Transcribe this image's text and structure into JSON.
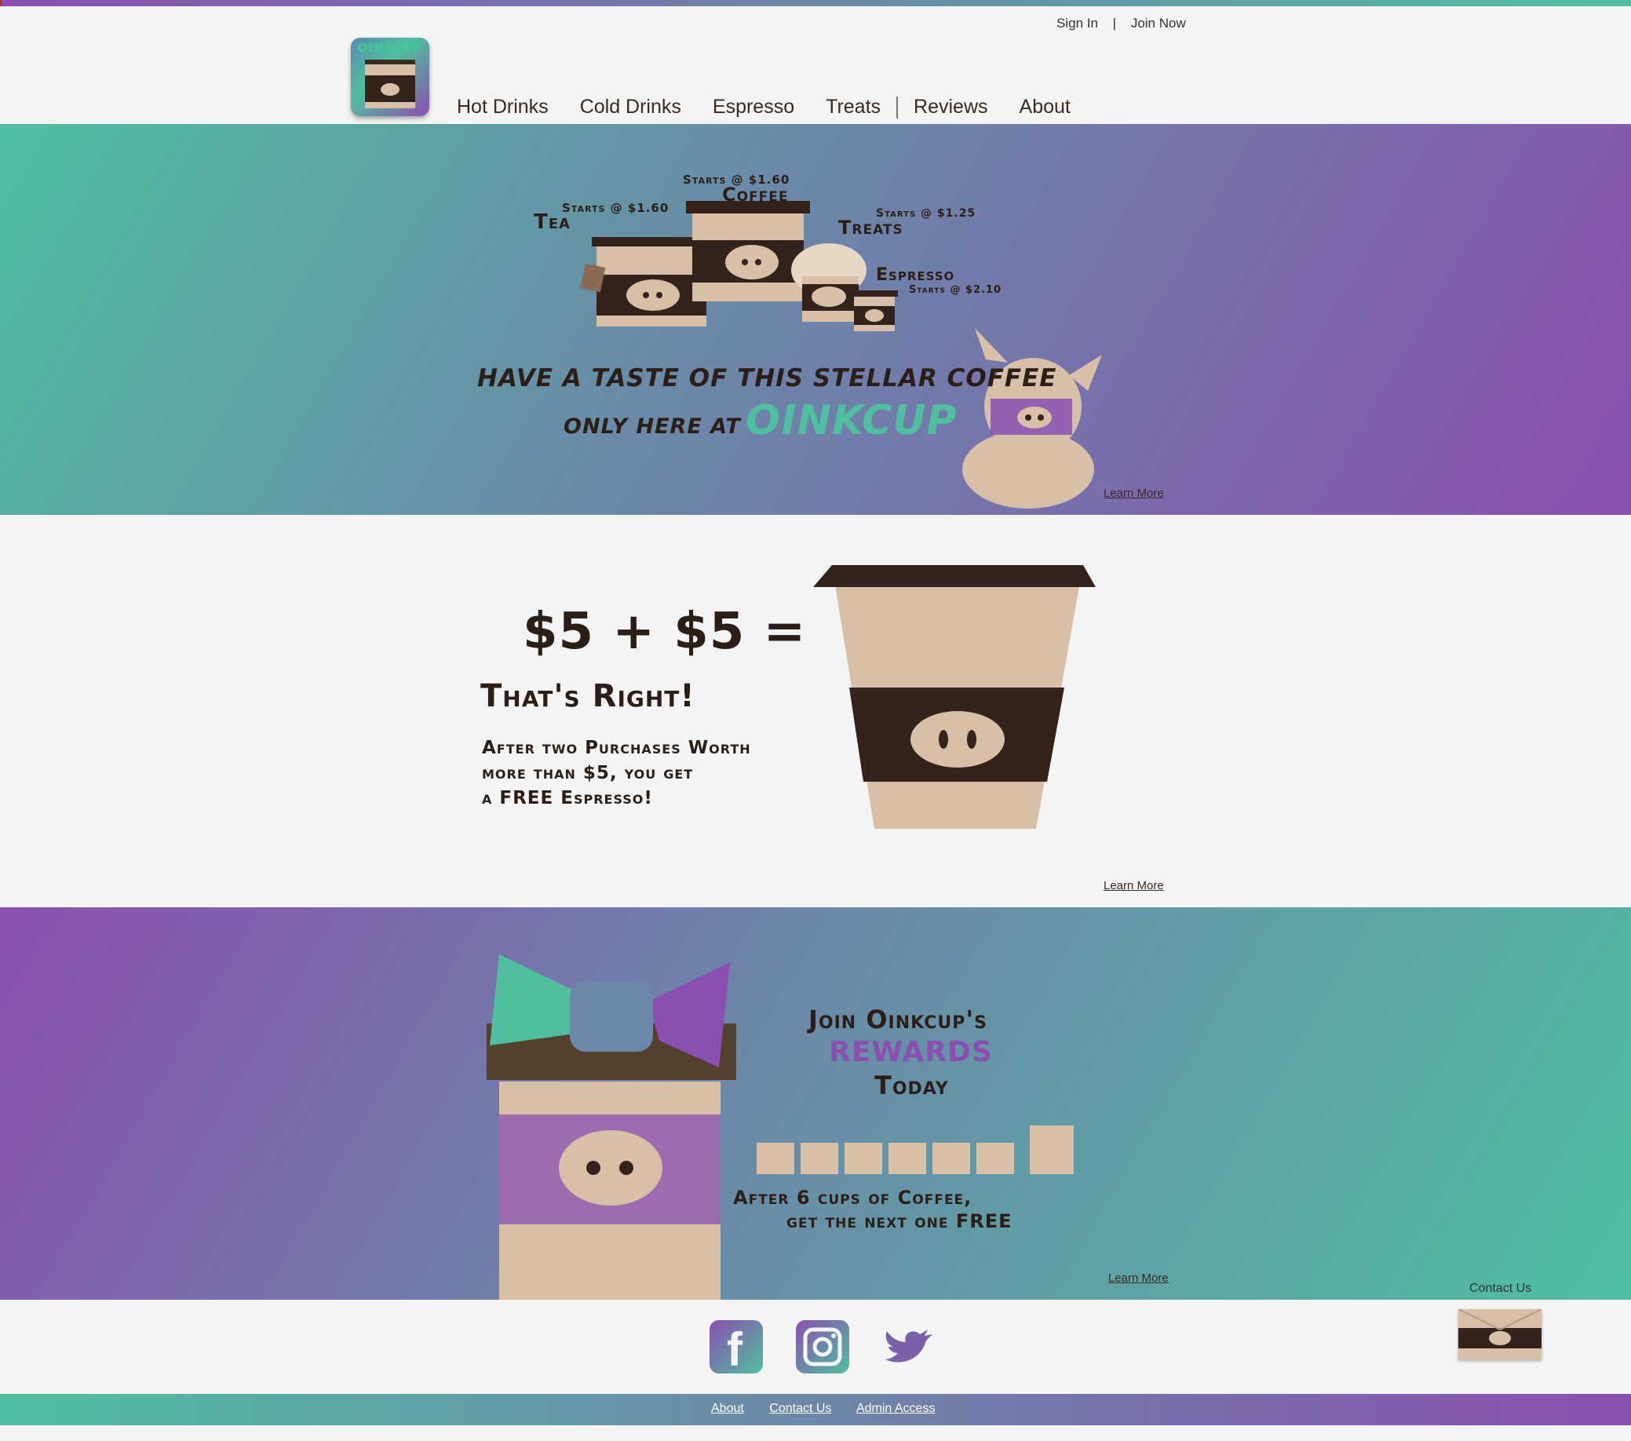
{
  "auth": {
    "sign_in": "Sign In",
    "separator": "|",
    "join_now": "Join Now"
  },
  "logo": {
    "text": "OINKCUP"
  },
  "nav": {
    "items": [
      "Hot Drinks",
      "Cold Drinks",
      "Espresso",
      "Treats",
      "Reviews",
      "About"
    ]
  },
  "hero": {
    "tea": "Tea",
    "tea_price": "Starts @ $1.60",
    "coffee": "Coffee",
    "coffee_price": "Starts @ $1.60",
    "treats": "Treats",
    "treats_price": "Starts @ $1.25",
    "espresso": "Espresso",
    "espresso_price": "Starts @ $2.10",
    "line1": "HAVE A TASTE OF THIS STELLAR COFFEE",
    "line2": "ONLY HERE AT",
    "brand": "OINKCUP",
    "learn_more": "Learn More"
  },
  "promo": {
    "equation": "$5 + $5 =",
    "headline": "That's Right!",
    "body1": "After two Purchases Worth",
    "body2": "more than $5, you get",
    "body3": "a FREE Espresso!",
    "learn_more": "Learn More"
  },
  "rewards": {
    "line1": "Join Oinkcup's",
    "line2": "REWARDS",
    "line3": "Today",
    "body1": "After 6 cups of Coffee,",
    "body2": "get the next one FREE",
    "learn_more": "Learn More"
  },
  "social": {
    "icons": [
      "facebook-icon",
      "instagram-icon",
      "twitter-icon"
    ]
  },
  "contact": {
    "label": "Contact Us"
  },
  "footer": {
    "links": [
      "About",
      "Contact Us",
      "Admin Access"
    ]
  },
  "colors": {
    "teal": "#4fbfa0",
    "purple": "#8a4fb0",
    "brown": "#33231a",
    "tan": "#d8bfa8"
  }
}
